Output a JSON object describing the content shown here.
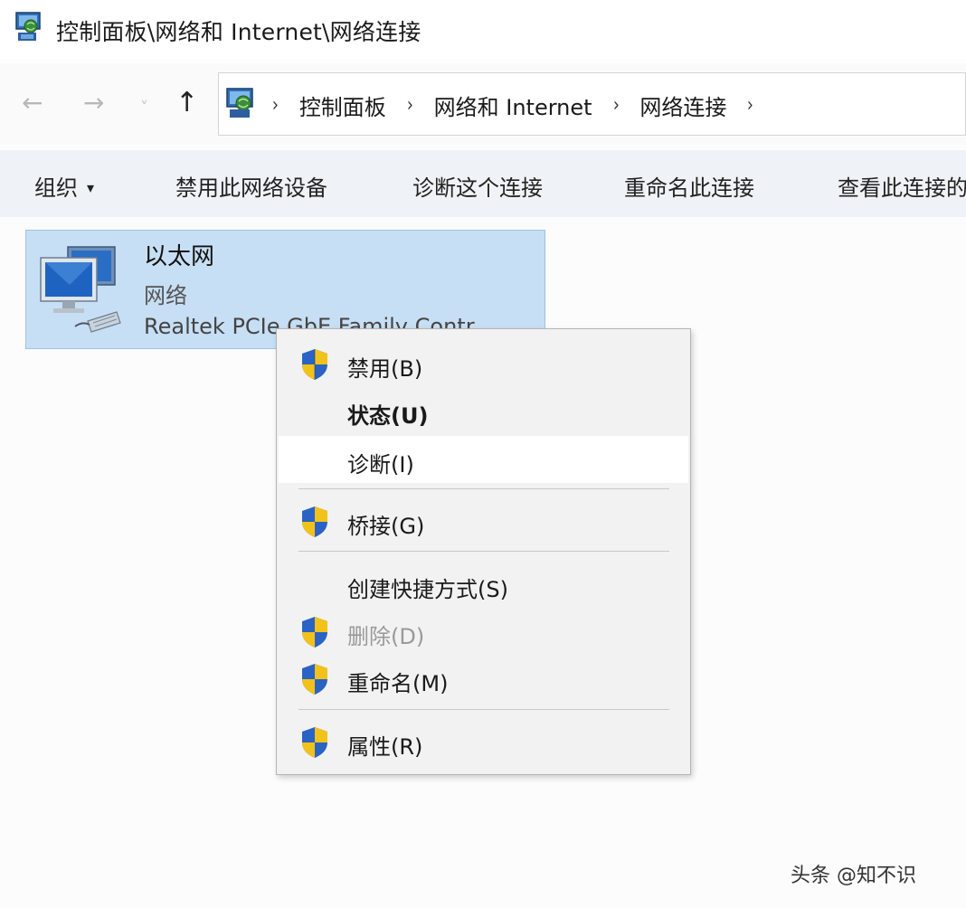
{
  "window": {
    "title": "控制面板\\网络和 Internet\\网络连接",
    "icon": "network-connections-icon"
  },
  "nav": {
    "back_icon": "←",
    "forward_icon": "→",
    "recent_icon": "˅",
    "up_icon": "↑",
    "breadcrumbs": [
      "控制面板",
      "网络和 Internet",
      "网络连接"
    ],
    "separator": "›"
  },
  "command_bar": {
    "organize": "组织",
    "organize_caret": "▾",
    "disable_device": "禁用此网络设备",
    "diagnose": "诊断这个连接",
    "rename": "重命名此连接",
    "view_status": "查看此连接的"
  },
  "adapter": {
    "name": "以太网",
    "type": "网络",
    "device": "Realtek PCIe GbE Family Contr..."
  },
  "context_menu": {
    "items": [
      {
        "label": "禁用(B)",
        "icon": "uac-shield-icon",
        "state": "normal"
      },
      {
        "label": "状态(U)",
        "icon": "",
        "state": "bold"
      },
      {
        "label": "诊断(I)",
        "icon": "",
        "state": "highlighted"
      },
      {
        "label": "桥接(G)",
        "icon": "uac-shield-icon",
        "state": "normal"
      },
      {
        "label": "创建快捷方式(S)",
        "icon": "",
        "state": "normal"
      },
      {
        "label": "删除(D)",
        "icon": "uac-shield-icon",
        "state": "disabled"
      },
      {
        "label": "重命名(M)",
        "icon": "uac-shield-icon",
        "state": "normal"
      },
      {
        "label": "属性(R)",
        "icon": "uac-shield-icon",
        "state": "normal"
      }
    ]
  },
  "watermark": "头条 @知不识",
  "colors": {
    "selection_bg": "#c7dff4",
    "command_bar_bg": "#eff2f6",
    "menu_bg": "#f2f2f2"
  }
}
